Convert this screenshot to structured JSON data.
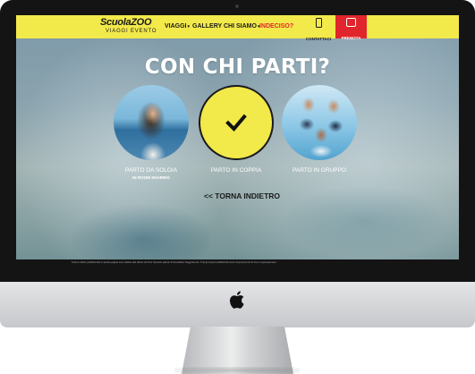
{
  "logo": {
    "name": "ScuolaZOO",
    "tagline": "VIAGGI EVENTO"
  },
  "nav": {
    "viaggi": "VIAGGI",
    "gallery": "GALLERY",
    "chi_siamo": "CHI SIAMO",
    "indeciso": "INDECISO?",
    "contattaci": "CONTATTACI",
    "prenota": "PRENOTA"
  },
  "main": {
    "heading": "CON CHI PARTI?",
    "options": [
      {
        "label": "PARTO DA SOLO/A",
        "sublabel": "IN ROOM SHARING"
      },
      {
        "label": "PARTO IN COPPIA"
      },
      {
        "label": "PARTO IN GRUPPO"
      }
    ],
    "back_link": "<< TORNA INDIETRO"
  },
  "footer": {
    "note": "Tutte le offerte pubblicizzate in questa pagina sono relative alle offerte dei Tour Operator partner di ScuolaZoo Viaggi Evento. Tutti gli importi pubblicizzati sono comprensivi di ciò che è espressamente"
  },
  "colors": {
    "accent": "#f2e94a",
    "red": "#e0262c",
    "dark": "#1a1a1a"
  },
  "icons": [
    "phone-icon",
    "calendar-icon",
    "check-icon",
    "apple-logo-icon",
    "chevron-down-icon"
  ]
}
